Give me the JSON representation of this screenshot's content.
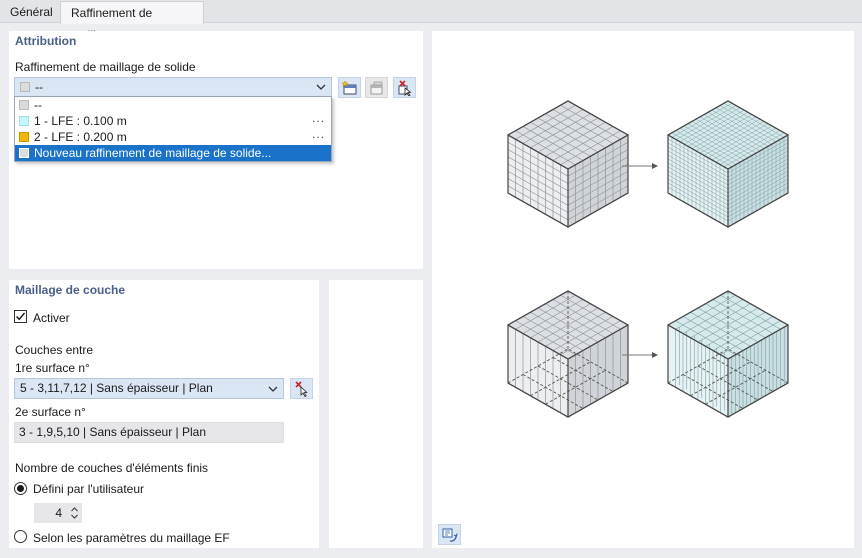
{
  "tabs": [
    {
      "label": "Général"
    },
    {
      "label": "Raffinement de maillage"
    }
  ],
  "attribution": {
    "title": "Attribution",
    "field_label": "Raffinement de maillage de solide",
    "combo_value": "--",
    "dropdown": {
      "items": [
        {
          "label": "--",
          "color": "#dcdcdc"
        },
        {
          "label": "1 - LFE : 0.100 m",
          "color": "#c8f8fb",
          "more": "..."
        },
        {
          "label": "2 - LFE : 0.200 m",
          "color": "#f2b807",
          "more": "..."
        },
        {
          "label": "Nouveau raffinement de maillage de solide...",
          "color": "#dcdcdc"
        }
      ]
    },
    "buttons": [
      "new-icon",
      "edit-icon",
      "pick-icon"
    ]
  },
  "layer_mesh": {
    "title": "Maillage de couche",
    "activate_label": "Activer",
    "activated": true,
    "layers_between": "Couches entre",
    "first_surface_label": "1re surface n°",
    "first_surface_value": "5 - 3,11,7,12 | Sans épaisseur | Plan",
    "second_surface_label": "2e surface n°",
    "second_surface_value": "3 - 1,9,5,10 | Sans épaisseur | Plan",
    "count_label": "Nombre de couches d'éléments finis",
    "option_user": "Défini par l'utilisateur",
    "option_user_selected": true,
    "layer_count": "4",
    "option_fe": "Selon les paramètres du maillage EF"
  },
  "colors": {
    "accent": "#1a73c8",
    "section_title": "#4a5e88",
    "combo_bg": "#dbe6f5"
  }
}
